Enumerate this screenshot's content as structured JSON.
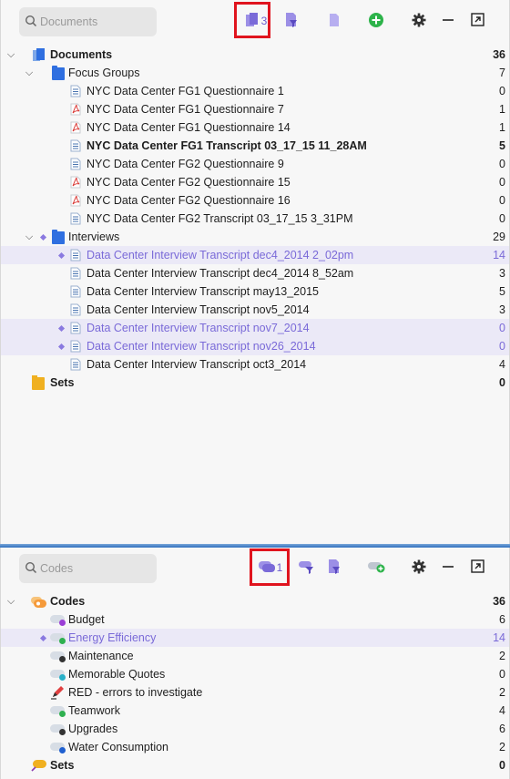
{
  "documents_panel": {
    "search_placeholder": "Documents",
    "selected_count": "3",
    "root": {
      "label": "Documents",
      "count": "36"
    },
    "focus_groups": {
      "label": "Focus Groups",
      "count": "7",
      "items": [
        {
          "label": "NYC Data Center FG1 Questionnaire 1",
          "count": "0",
          "type": "doc",
          "bold": false,
          "selected": false
        },
        {
          "label": "NYC Data Center FG1 Questionnaire 7",
          "count": "1",
          "type": "pdf",
          "bold": false,
          "selected": false
        },
        {
          "label": "NYC Data Center FG1 Questionnaire 14",
          "count": "1",
          "type": "pdf",
          "bold": false,
          "selected": false
        },
        {
          "label": "NYC Data Center FG1 Transcript 03_17_15 11_28AM",
          "count": "5",
          "type": "doc",
          "bold": true,
          "selected": false
        },
        {
          "label": "NYC Data Center FG2 Questionnaire 9",
          "count": "0",
          "type": "doc",
          "bold": false,
          "selected": false
        },
        {
          "label": "NYC Data Center FG2 Questionnaire 15",
          "count": "0",
          "type": "pdf",
          "bold": false,
          "selected": false
        },
        {
          "label": "NYC Data Center FG2 Questionnaire 16",
          "count": "0",
          "type": "pdf",
          "bold": false,
          "selected": false
        },
        {
          "label": "NYC Data Center FG2 Transcript 03_17_15 3_31PM",
          "count": "0",
          "type": "doc",
          "bold": false,
          "selected": false
        }
      ]
    },
    "interviews": {
      "label": "Interviews",
      "count": "29",
      "items": [
        {
          "label": "Data Center Interview Transcript dec4_2014 2_02pm",
          "count": "14",
          "type": "doc",
          "selected": true
        },
        {
          "label": "Data Center Interview Transcript dec4_2014 8_52am",
          "count": "3",
          "type": "doc",
          "selected": false
        },
        {
          "label": "Data Center Interview Transcript may13_2015",
          "count": "5",
          "type": "doc",
          "selected": false
        },
        {
          "label": "Data Center Interview Transcript nov5_2014",
          "count": "3",
          "type": "doc",
          "selected": false
        },
        {
          "label": "Data Center Interview Transcript nov7_2014",
          "count": "0",
          "type": "doc",
          "selected": true
        },
        {
          "label": "Data Center Interview Transcript nov26_2014",
          "count": "0",
          "type": "doc",
          "selected": true
        },
        {
          "label": "Data Center Interview Transcript oct3_2014",
          "count": "4",
          "type": "doc",
          "selected": false
        }
      ]
    },
    "sets": {
      "label": "Sets",
      "count": "0"
    }
  },
  "codes_panel": {
    "search_placeholder": "Codes",
    "selected_count": "1",
    "root": {
      "label": "Codes",
      "count": "36"
    },
    "items": [
      {
        "label": "Budget",
        "count": "6",
        "color": "#9b3fd6",
        "selected": false,
        "icon": "code-icon"
      },
      {
        "label": "Energy Efficiency",
        "count": "14",
        "color": "#2fb050",
        "selected": true,
        "icon": "code-icon"
      },
      {
        "label": "Maintenance",
        "count": "2",
        "color": "#333333",
        "selected": false,
        "icon": "code-icon"
      },
      {
        "label": "Memorable Quotes",
        "count": "0",
        "color": "#29b0c8",
        "selected": false,
        "icon": "code-icon"
      },
      {
        "label": "RED - errors to investigate",
        "count": "2",
        "color": "#e04040",
        "selected": false,
        "icon": "pen-icon"
      },
      {
        "label": "Teamwork",
        "count": "4",
        "color": "#2fb050",
        "selected": false,
        "icon": "code-icon"
      },
      {
        "label": "Upgrades",
        "count": "6",
        "color": "#333333",
        "selected": false,
        "icon": "code-icon"
      },
      {
        "label": "Water Consumption",
        "count": "2",
        "color": "#2060d0",
        "selected": false,
        "icon": "code-icon"
      }
    ],
    "sets": {
      "label": "Sets",
      "count": "0"
    }
  },
  "colors": {
    "accent": "#7a6ad8",
    "folder": "#2f6fe0",
    "sets": "#f0b020",
    "add_green": "#2db34a",
    "highlight_box": "#e0141e"
  }
}
